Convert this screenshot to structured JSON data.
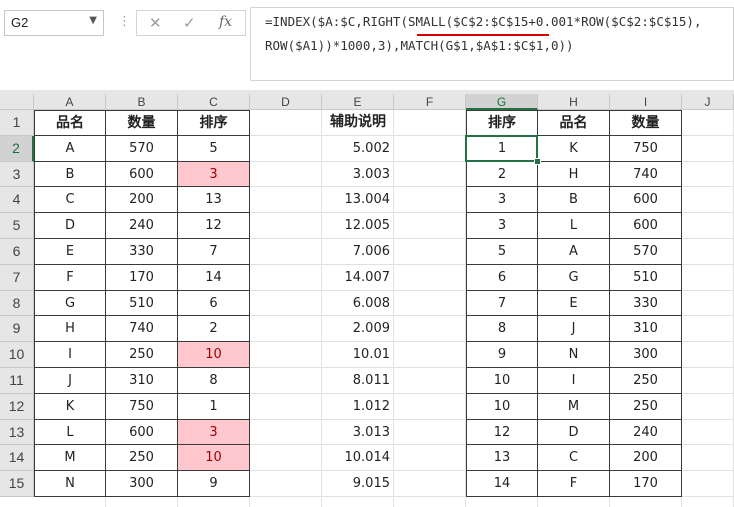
{
  "name_box": {
    "value": "G2"
  },
  "formula_bar": {
    "cancel_icon": "✕",
    "confirm_icon": "✓",
    "function_icon": "fx",
    "line1": "=INDEX($A:$C,RIGHT(SMALL($C$2:$C$15+0.001*ROW($C$2:$C$15),",
    "line2": "ROW($A1))*1000,3),MATCH(G$1,$A$1:$C$1,0))",
    "underline_color": "#d40000"
  },
  "columns": [
    "A",
    "B",
    "C",
    "D",
    "E",
    "F",
    "G",
    "H",
    "I",
    "J"
  ],
  "rows": [
    "1",
    "2",
    "3",
    "4",
    "5",
    "6",
    "7",
    "8",
    "9",
    "10",
    "11",
    "12",
    "13",
    "14",
    "15"
  ],
  "selected_column": "G",
  "selected_row": "2",
  "table_left": {
    "headers": [
      "品名",
      "数量",
      "排序"
    ],
    "rows": [
      [
        "A",
        "570",
        "5"
      ],
      [
        "B",
        "600",
        "3"
      ],
      [
        "C",
        "200",
        "13"
      ],
      [
        "D",
        "240",
        "12"
      ],
      [
        "E",
        "330",
        "7"
      ],
      [
        "F",
        "170",
        "14"
      ],
      [
        "G",
        "510",
        "6"
      ],
      [
        "H",
        "740",
        "2"
      ],
      [
        "I",
        "250",
        "10"
      ],
      [
        "J",
        "310",
        "8"
      ],
      [
        "K",
        "750",
        "1"
      ],
      [
        "L",
        "600",
        "3"
      ],
      [
        "M",
        "250",
        "10"
      ],
      [
        "N",
        "300",
        "9"
      ]
    ],
    "highlighted_rows": [
      1,
      8,
      11,
      12
    ],
    "highlight_bg": "#ffc7ce",
    "highlight_fg": "#9c0006"
  },
  "helper_column": {
    "header": "辅助说明",
    "values": [
      "5.002",
      "3.003",
      "13.004",
      "12.005",
      "7.006",
      "14.007",
      "6.008",
      "2.009",
      "10.01",
      "8.011",
      "1.012",
      "3.013",
      "10.014",
      "9.015"
    ]
  },
  "table_right": {
    "headers": [
      "排序",
      "品名",
      "数量"
    ],
    "rows": [
      [
        "1",
        "K",
        "750"
      ],
      [
        "2",
        "H",
        "740"
      ],
      [
        "3",
        "B",
        "600"
      ],
      [
        "3",
        "L",
        "600"
      ],
      [
        "5",
        "A",
        "570"
      ],
      [
        "6",
        "G",
        "510"
      ],
      [
        "7",
        "E",
        "330"
      ],
      [
        "8",
        "J",
        "310"
      ],
      [
        "9",
        "N",
        "300"
      ],
      [
        "10",
        "I",
        "250"
      ],
      [
        "10",
        "M",
        "250"
      ],
      [
        "12",
        "D",
        "240"
      ],
      [
        "13",
        "C",
        "200"
      ],
      [
        "14",
        "F",
        "170"
      ]
    ]
  },
  "accent_color": "#217346"
}
